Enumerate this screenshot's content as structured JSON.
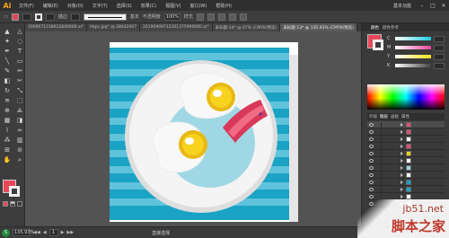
{
  "app": {
    "logo": "Ai"
  },
  "menu": [
    "文件(F)",
    "编辑(E)",
    "对象(O)",
    "文字(T)",
    "选择(S)",
    "效果(C)",
    "视图(V)",
    "窗口(W)",
    "帮助(H)"
  ],
  "workspace": "基本功能",
  "window_controls": [
    "–",
    "□",
    "✕"
  ],
  "control_bar": {
    "fill_color": "#d84a5a",
    "stroke_label": "描边",
    "style_label": "基本",
    "opacity_label": "不透明度",
    "opacity_value": "100%",
    "style_text": "样式"
  },
  "tabs": [
    {
      "label": "1909071238612840008.ai*",
      "active": false
    },
    {
      "label": "hbpc.jpg* @ 28442007",
      "active": false
    },
    {
      "label": "20190909712361375990000.ai*",
      "active": false
    },
    {
      "label": "未标题-14* @ 67% (CMYK/预览)",
      "active": false
    },
    {
      "label": "未标题-13* @ 135.93% (CMYK/预览)",
      "active": true
    }
  ],
  "colors": {
    "fill": "#e6485a",
    "stroke": "#f0f0f0",
    "teal": "#1aa3c4",
    "teal_stripe": "#5fc3dc",
    "plate": "#f2f2f2",
    "plate_rim": "#dedede",
    "inner": "#9fd8e4",
    "yolk": "#f7d21e",
    "bacon_dark": "#d8385a",
    "bacon_light": "#f06b83"
  },
  "tools_left": [
    "selection-icon",
    "pen-icon",
    "type-icon",
    "line-icon",
    "rect-icon",
    "brush-icon",
    "pencil-icon",
    "eraser-icon",
    "rotate-icon",
    "scale-icon",
    "warp-icon",
    "free-transform-icon",
    "shape-builder-icon",
    "perspective-icon",
    "mesh-icon",
    "gradient-icon",
    "eyedropper-icon",
    "blend-icon",
    "symbol-sprayer-icon",
    "graph-icon",
    "artboard-icon",
    "slice-icon",
    "hand-icon",
    "zoom-icon"
  ],
  "color_panel": {
    "tabs": [
      "颜色",
      "颜色参考"
    ],
    "sliders": [
      {
        "label": "C",
        "color": "#1ecbe1"
      },
      {
        "label": "M",
        "color": "#e8469c"
      },
      {
        "label": "Y",
        "color": "#f0e11a"
      },
      {
        "label": "K",
        "color": "#444444"
      }
    ]
  },
  "layers_panel": {
    "tabs": [
      "外观",
      "图层",
      "画板",
      "属性"
    ],
    "rows": [
      {
        "thumb": "#e05070",
        "selected": true
      },
      {
        "thumb": "#e05070",
        "selected": false
      },
      {
        "thumb": "#f2f2f2",
        "selected": false
      },
      {
        "thumb": "#e05070",
        "selected": false
      },
      {
        "thumb": "#f2d21e",
        "selected": false
      },
      {
        "thumb": "#f2f2f2",
        "selected": false
      },
      {
        "thumb": "#9fd8e4",
        "selected": false
      },
      {
        "thumb": "#f2f2f2",
        "selected": false
      },
      {
        "thumb": "#1aa3c4",
        "selected": false
      },
      {
        "thumb": "#1aa3c4",
        "selected": false
      },
      {
        "thumb": "#ffffff",
        "selected": false
      },
      {
        "thumb": "#ffffff",
        "selected": false
      }
    ]
  },
  "status": {
    "zoom": "135.93%",
    "page": "1",
    "tool": "直接选择"
  },
  "watermark": {
    "url": "jb51.net",
    "name": "脚本之家"
  }
}
